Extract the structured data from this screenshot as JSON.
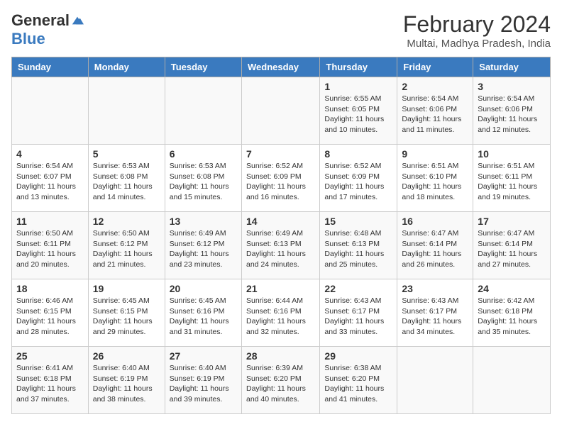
{
  "logo": {
    "general": "General",
    "blue": "Blue"
  },
  "title": "February 2024",
  "subtitle": "Multai, Madhya Pradesh, India",
  "headers": [
    "Sunday",
    "Monday",
    "Tuesday",
    "Wednesday",
    "Thursday",
    "Friday",
    "Saturday"
  ],
  "weeks": [
    [
      {
        "day": "",
        "info": ""
      },
      {
        "day": "",
        "info": ""
      },
      {
        "day": "",
        "info": ""
      },
      {
        "day": "",
        "info": ""
      },
      {
        "day": "1",
        "info": "Sunrise: 6:55 AM\nSunset: 6:05 PM\nDaylight: 11 hours and 10 minutes."
      },
      {
        "day": "2",
        "info": "Sunrise: 6:54 AM\nSunset: 6:06 PM\nDaylight: 11 hours and 11 minutes."
      },
      {
        "day": "3",
        "info": "Sunrise: 6:54 AM\nSunset: 6:06 PM\nDaylight: 11 hours and 12 minutes."
      }
    ],
    [
      {
        "day": "4",
        "info": "Sunrise: 6:54 AM\nSunset: 6:07 PM\nDaylight: 11 hours and 13 minutes."
      },
      {
        "day": "5",
        "info": "Sunrise: 6:53 AM\nSunset: 6:08 PM\nDaylight: 11 hours and 14 minutes."
      },
      {
        "day": "6",
        "info": "Sunrise: 6:53 AM\nSunset: 6:08 PM\nDaylight: 11 hours and 15 minutes."
      },
      {
        "day": "7",
        "info": "Sunrise: 6:52 AM\nSunset: 6:09 PM\nDaylight: 11 hours and 16 minutes."
      },
      {
        "day": "8",
        "info": "Sunrise: 6:52 AM\nSunset: 6:09 PM\nDaylight: 11 hours and 17 minutes."
      },
      {
        "day": "9",
        "info": "Sunrise: 6:51 AM\nSunset: 6:10 PM\nDaylight: 11 hours and 18 minutes."
      },
      {
        "day": "10",
        "info": "Sunrise: 6:51 AM\nSunset: 6:11 PM\nDaylight: 11 hours and 19 minutes."
      }
    ],
    [
      {
        "day": "11",
        "info": "Sunrise: 6:50 AM\nSunset: 6:11 PM\nDaylight: 11 hours and 20 minutes."
      },
      {
        "day": "12",
        "info": "Sunrise: 6:50 AM\nSunset: 6:12 PM\nDaylight: 11 hours and 21 minutes."
      },
      {
        "day": "13",
        "info": "Sunrise: 6:49 AM\nSunset: 6:12 PM\nDaylight: 11 hours and 23 minutes."
      },
      {
        "day": "14",
        "info": "Sunrise: 6:49 AM\nSunset: 6:13 PM\nDaylight: 11 hours and 24 minutes."
      },
      {
        "day": "15",
        "info": "Sunrise: 6:48 AM\nSunset: 6:13 PM\nDaylight: 11 hours and 25 minutes."
      },
      {
        "day": "16",
        "info": "Sunrise: 6:47 AM\nSunset: 6:14 PM\nDaylight: 11 hours and 26 minutes."
      },
      {
        "day": "17",
        "info": "Sunrise: 6:47 AM\nSunset: 6:14 PM\nDaylight: 11 hours and 27 minutes."
      }
    ],
    [
      {
        "day": "18",
        "info": "Sunrise: 6:46 AM\nSunset: 6:15 PM\nDaylight: 11 hours and 28 minutes."
      },
      {
        "day": "19",
        "info": "Sunrise: 6:45 AM\nSunset: 6:15 PM\nDaylight: 11 hours and 29 minutes."
      },
      {
        "day": "20",
        "info": "Sunrise: 6:45 AM\nSunset: 6:16 PM\nDaylight: 11 hours and 31 minutes."
      },
      {
        "day": "21",
        "info": "Sunrise: 6:44 AM\nSunset: 6:16 PM\nDaylight: 11 hours and 32 minutes."
      },
      {
        "day": "22",
        "info": "Sunrise: 6:43 AM\nSunset: 6:17 PM\nDaylight: 11 hours and 33 minutes."
      },
      {
        "day": "23",
        "info": "Sunrise: 6:43 AM\nSunset: 6:17 PM\nDaylight: 11 hours and 34 minutes."
      },
      {
        "day": "24",
        "info": "Sunrise: 6:42 AM\nSunset: 6:18 PM\nDaylight: 11 hours and 35 minutes."
      }
    ],
    [
      {
        "day": "25",
        "info": "Sunrise: 6:41 AM\nSunset: 6:18 PM\nDaylight: 11 hours and 37 minutes."
      },
      {
        "day": "26",
        "info": "Sunrise: 6:40 AM\nSunset: 6:19 PM\nDaylight: 11 hours and 38 minutes."
      },
      {
        "day": "27",
        "info": "Sunrise: 6:40 AM\nSunset: 6:19 PM\nDaylight: 11 hours and 39 minutes."
      },
      {
        "day": "28",
        "info": "Sunrise: 6:39 AM\nSunset: 6:20 PM\nDaylight: 11 hours and 40 minutes."
      },
      {
        "day": "29",
        "info": "Sunrise: 6:38 AM\nSunset: 6:20 PM\nDaylight: 11 hours and 41 minutes."
      },
      {
        "day": "",
        "info": ""
      },
      {
        "day": "",
        "info": ""
      }
    ]
  ]
}
